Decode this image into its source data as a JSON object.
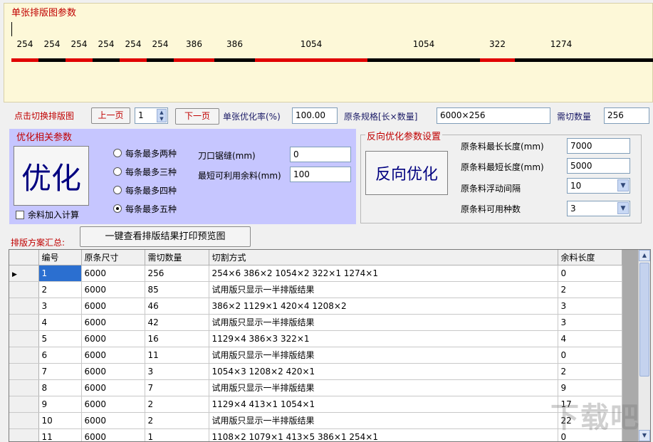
{
  "top_panel": {
    "title": "单张排版图参数",
    "segments": [
      {
        "label": "254",
        "color": "#e00000"
      },
      {
        "label": "254",
        "color": "#000000"
      },
      {
        "label": "254",
        "color": "#e00000"
      },
      {
        "label": "254",
        "color": "#000000"
      },
      {
        "label": "254",
        "color": "#e00000"
      },
      {
        "label": "254",
        "color": "#000000"
      },
      {
        "label": "386",
        "color": "#e00000"
      },
      {
        "label": "386",
        "color": "#000000"
      },
      {
        "label": "1054",
        "color": "#e00000"
      },
      {
        "label": "1054",
        "color": "#000000"
      },
      {
        "label": "322",
        "color": "#e00000"
      },
      {
        "label": "1274",
        "color": "#000000"
      }
    ]
  },
  "controls": {
    "switch_label": "点击切换排版图",
    "prev_button": "上一页",
    "page_value": "1",
    "next_button": "下一页",
    "rate_label": "单张优化率(%)",
    "rate_value": "100.00",
    "spec_label": "原条规格[长×数量]",
    "spec_value": "6000×256",
    "qty_label": "需切数量",
    "qty_value": "256"
  },
  "optimize_panel": {
    "title": "优化相关参数",
    "optimize_button": "优化",
    "radios": [
      {
        "label": "每条最多两种",
        "checked": false
      },
      {
        "label": "每条最多三种",
        "checked": false
      },
      {
        "label": "每条最多四种",
        "checked": false
      },
      {
        "label": "每条最多五种",
        "checked": true
      }
    ],
    "checkbox_label": "余料加入计算",
    "kerf_label": "刀口锯缝(mm)",
    "kerf_value": "0",
    "min_remnant_label": "最短可利用余料(mm)",
    "min_remnant_value": "100"
  },
  "reverse_panel": {
    "title": "反向优化参数设置",
    "reverse_button": "反向优化",
    "max_len_label": "原条料最长长度(mm)",
    "max_len_value": "7000",
    "min_len_label": "原条料最短长度(mm)",
    "min_len_value": "5000",
    "float_label": "原条料浮动间隔",
    "float_value": "10",
    "kinds_label": "原条料可用种数",
    "kinds_value": "3"
  },
  "summary": {
    "label": "排版方案汇总:",
    "print_button": "一键查看排版结果打印预览图"
  },
  "table": {
    "columns": [
      "编号",
      "原条尺寸",
      "需切数量",
      "切割方式",
      "余料长度"
    ],
    "rows": [
      [
        "1",
        "6000",
        "256",
        "254×6 386×2 1054×2 322×1 1274×1",
        "0"
      ],
      [
        "2",
        "6000",
        "85",
        " 试用版只显示一半排版结果",
        "2"
      ],
      [
        "3",
        "6000",
        "46",
        "386×2 1129×1 420×4 1208×2",
        "3"
      ],
      [
        "4",
        "6000",
        "42",
        " 试用版只显示一半排版结果",
        "3"
      ],
      [
        "5",
        "6000",
        "16",
        "1129×4 386×3 322×1",
        "4"
      ],
      [
        "6",
        "6000",
        "11",
        " 试用版只显示一半排版结果",
        "0"
      ],
      [
        "7",
        "6000",
        "3",
        "1054×3 1208×2 420×1",
        "2"
      ],
      [
        "8",
        "6000",
        "7",
        " 试用版只显示一半排版结果",
        "9"
      ],
      [
        "9",
        "6000",
        "2",
        "1129×4 413×1 1054×1",
        "17"
      ],
      [
        "10",
        "6000",
        "2",
        " 试用版只显示一半排版结果",
        "22"
      ],
      [
        "11",
        "6000",
        "1",
        "1108×2 1079×1 413×5 386×1 254×1",
        "0"
      ]
    ]
  },
  "watermark": "下载吧"
}
